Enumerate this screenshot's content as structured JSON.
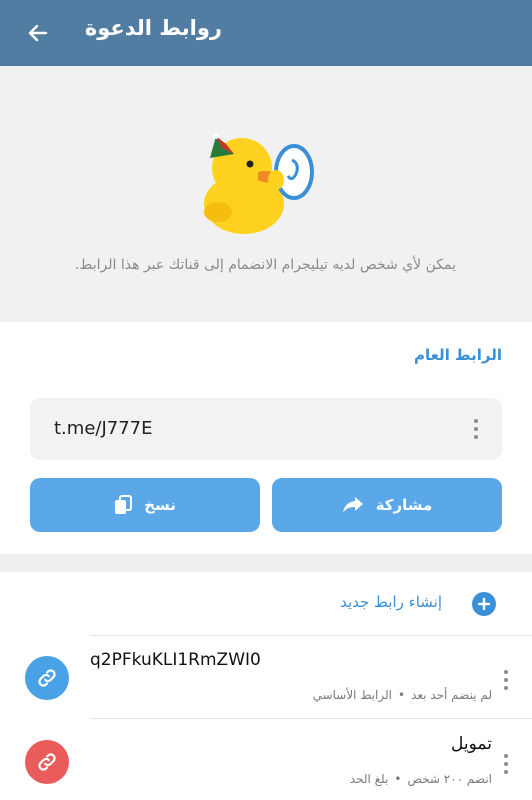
{
  "appbar": {
    "title": "روابط الدعوة"
  },
  "hero": {
    "description": "يمكن لأي شخص لديه تيليجرام الانضمام إلى قناتك عبر هذا الرابط."
  },
  "public_link": {
    "section_title": "الرابط العام",
    "link": "t.me/J777E",
    "share_label": "مشاركة",
    "copy_label": "نسخ"
  },
  "create": {
    "label": "إنشاء رابط جديد"
  },
  "links": [
    {
      "title": "q2PFkuKLI1RmZWI0",
      "status": "لم ينضم أحد بعد",
      "note": "الرابط الأساسي",
      "color": "#4aa2e6"
    },
    {
      "title": "تمويل",
      "status": "انضم ٢٠٠ شخص",
      "note": "بلغ الحد",
      "color": "#ea5c5c"
    }
  ],
  "colors": {
    "header": "#527da3",
    "accent": "#3a8fd6",
    "button": "#5aa8e8"
  },
  "icons": [
    "back-arrow-icon",
    "duck-sticker",
    "more-vertical-icon",
    "share-arrow-icon",
    "copy-icon",
    "plus-icon",
    "link-icon"
  ]
}
